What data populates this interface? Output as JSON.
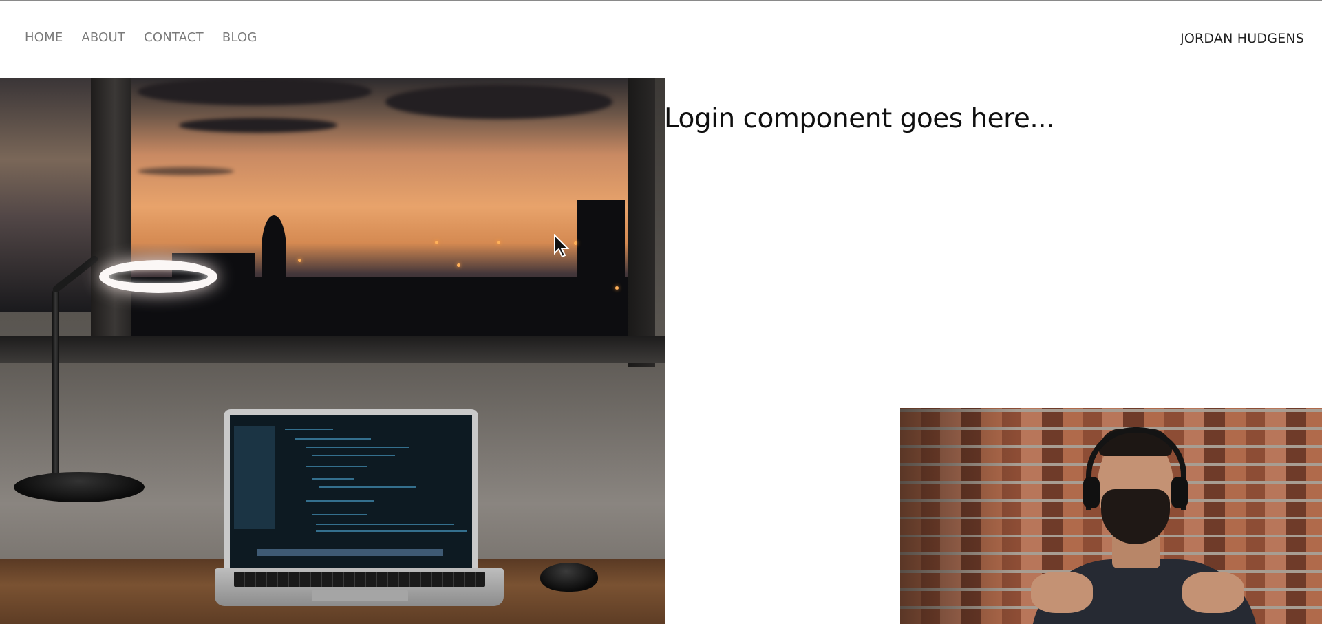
{
  "nav": {
    "items": [
      {
        "label": "HOME"
      },
      {
        "label": "ABOUT"
      },
      {
        "label": "CONTACT"
      },
      {
        "label": "BLOG"
      }
    ]
  },
  "brand": {
    "name": "JORDAN HUDGENS"
  },
  "main": {
    "placeholder_text": "Login component goes here..."
  },
  "images": {
    "hero": "desk-laptop-sunset-window-photo",
    "webcam": "presenter-webcam-overlay"
  }
}
